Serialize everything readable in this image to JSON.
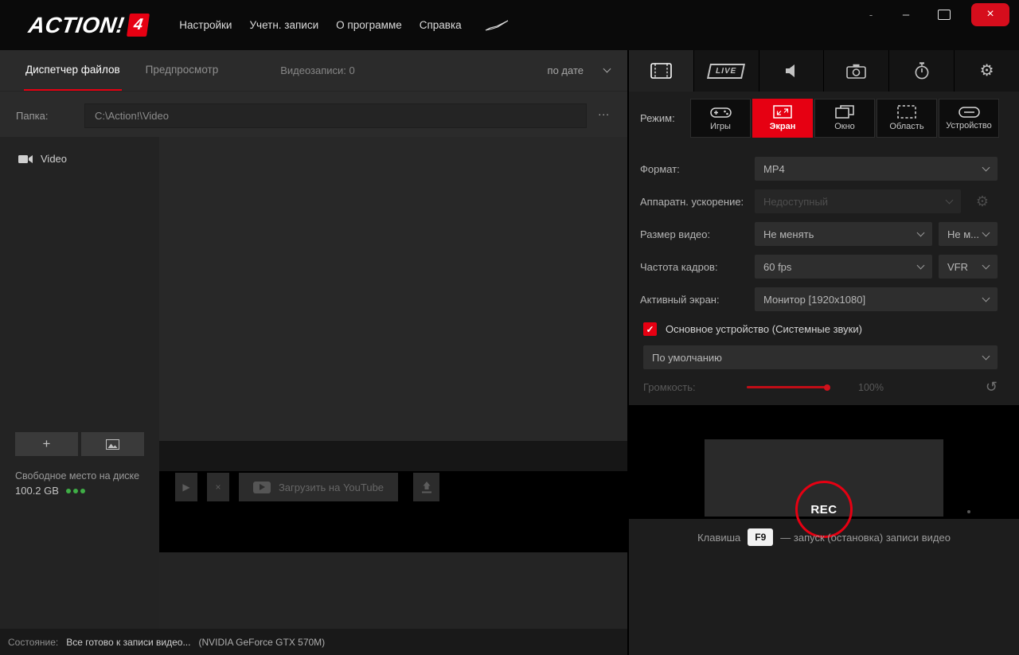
{
  "accent_color": "#e60012",
  "icons": {
    "gear": "⚙",
    "play": "▶",
    "close": "×",
    "reset": "↺",
    "plus": "+",
    "check": "✓",
    "minimize": "–",
    "dash": "-"
  },
  "titlebar": {
    "logo_text": "ACTION!",
    "logo_badge": "4",
    "menu": [
      "Настройки",
      "Учетн. записи",
      "О программе",
      "Справка"
    ]
  },
  "file_manager": {
    "tab_file_manager": "Диспетчер файлов",
    "tab_preview": "Предпросмотр",
    "records_count": "Видеозаписи: 0",
    "sort_by": "по дате",
    "folder_label": "Папка:",
    "folder_path": "C:\\Action!\\Video",
    "browse_button": "...",
    "video_item": "Video",
    "free_space_label": "Свободное место на диске",
    "free_space_value": "100.2 GB",
    "youtube_button": "Загрузить на YouTube"
  },
  "status_bar": {
    "label": "Состояние:",
    "message": "Все готово к записи видео...",
    "device": "(NVIDIA GeForce GTX 570M)"
  },
  "recorder": {
    "live_label": "LIVE",
    "mode_label": "Режим:",
    "modes": [
      "Игры",
      "Экран",
      "Окно",
      "Область",
      "Устройство"
    ],
    "active_mode": "Экран",
    "format_label": "Формат:",
    "format_value": "MP4",
    "hw_accel_label": "Аппаратн. ускорение:",
    "hw_accel_value": "Недоступный",
    "video_size_label": "Размер видео:",
    "video_size_value": "Не менять",
    "video_size_value2": "Не м...",
    "framerate_label": "Частота кадров:",
    "framerate_value": "60 fps",
    "framerate_mode": "VFR",
    "active_screen_label": "Активный экран:",
    "active_screen_value": "Монитор [1920x1080]",
    "audio_checkbox_label": "Основное устройство (Системные звуки)",
    "audio_checked": true,
    "audio_device_value": "По умолчанию",
    "volume_label": "Громкость:",
    "volume_value": "100%",
    "rec_button": "REC",
    "hotkey_prefix": "Клавиша",
    "hotkey_key": "F9",
    "hotkey_suffix": "— запуск (остановка) записи видео"
  }
}
